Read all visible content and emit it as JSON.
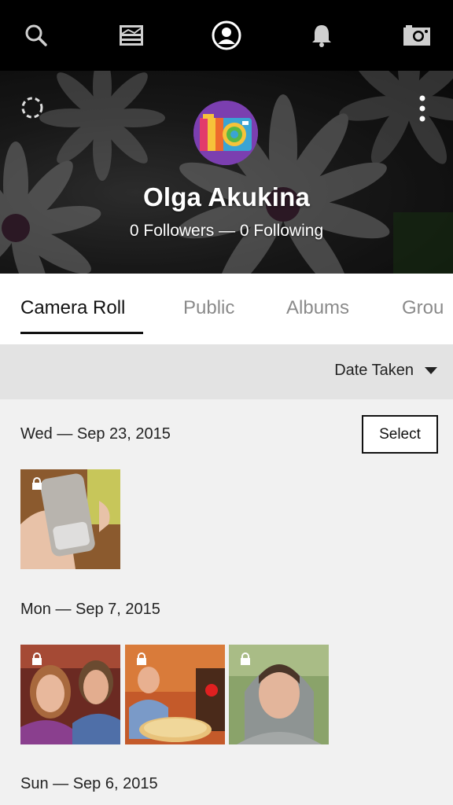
{
  "nav": {
    "icons": [
      "search-icon",
      "feed-icon",
      "profile-icon",
      "bell-icon",
      "camera-icon"
    ]
  },
  "profile": {
    "name": "Olga Akukina",
    "followers_line": "0 Followers — 0 Following"
  },
  "tabs": [
    "Camera Roll",
    "Public",
    "Albums",
    "Grou"
  ],
  "sort": {
    "label": "Date Taken"
  },
  "select_label": "Select",
  "groups": [
    {
      "date": "Wed — Sep 23, 2015",
      "photos": [
        "phone-case-photo"
      ]
    },
    {
      "date": "Mon — Sep 7, 2015",
      "photos": [
        "couple-selfie-photo",
        "man-with-pizza-photo",
        "woman-hood-photo"
      ]
    },
    {
      "date": "Sun — Sep 6, 2015",
      "photos": []
    }
  ],
  "colors": {
    "accent_avatar": "#7b3fb0",
    "nav_bg": "#000000",
    "sortbar_bg": "#e3e3e3"
  }
}
